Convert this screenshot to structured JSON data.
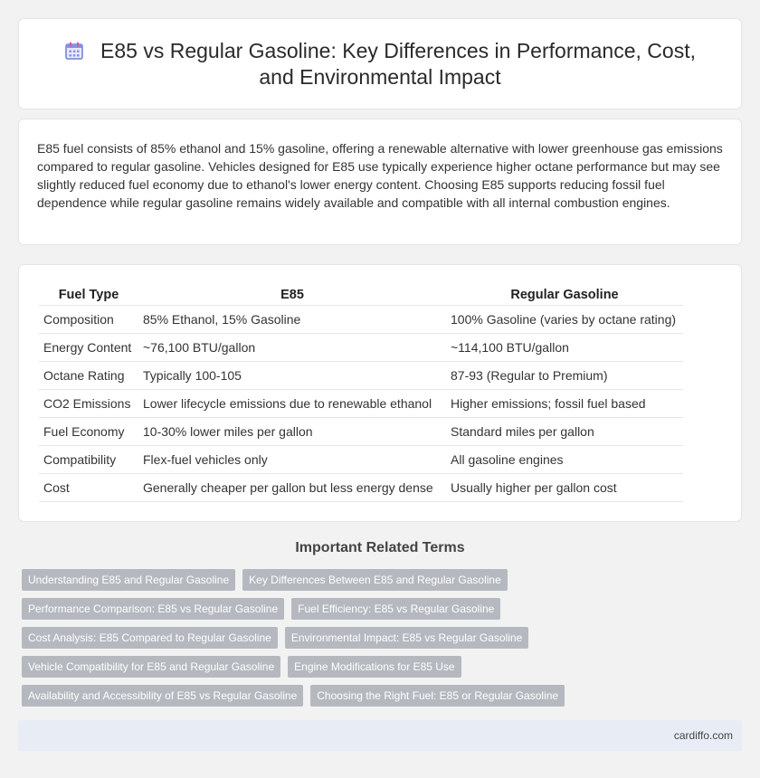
{
  "title": "E85 vs Regular Gasoline: Key Differences in Performance, Cost, and Environmental Impact",
  "title_icon": "calendar-icon",
  "intro": "E85 fuel consists of 85% ethanol and 15% gasoline, offering a renewable alternative with lower greenhouse gas emissions compared to regular gasoline. Vehicles designed for E85 use typically experience higher octane performance but may see slightly reduced fuel economy due to ethanol's lower energy content. Choosing E85 supports reducing fossil fuel dependence while regular gasoline remains widely available and compatible with all internal combustion engines.",
  "table": {
    "headers": [
      "Fuel Type",
      "E85",
      "Regular Gasoline"
    ],
    "rows": [
      [
        "Composition",
        "85% Ethanol, 15% Gasoline",
        "100% Gasoline (varies by octane rating)"
      ],
      [
        "Energy Content",
        "~76,100 BTU/gallon",
        "~114,100 BTU/gallon"
      ],
      [
        "Octane Rating",
        "Typically 100-105",
        "87-93 (Regular to Premium)"
      ],
      [
        "CO2 Emissions",
        "Lower lifecycle emissions due to renewable ethanol",
        "Higher emissions; fossil fuel based"
      ],
      [
        "Fuel Economy",
        "10-30% lower miles per gallon",
        "Standard miles per gallon"
      ],
      [
        "Compatibility",
        "Flex-fuel vehicles only",
        "All gasoline engines"
      ],
      [
        "Cost",
        "Generally cheaper per gallon but less energy dense",
        "Usually higher per gallon cost"
      ]
    ]
  },
  "related": {
    "heading": "Important Related Terms",
    "rows": [
      [
        "Understanding E85 and Regular Gasoline",
        "Key Differences Between E85 and Regular Gasoline"
      ],
      [
        "Performance Comparison: E85 vs Regular Gasoline",
        "Fuel Efficiency: E85 vs Regular Gasoline"
      ],
      [
        "Cost Analysis: E85 Compared to Regular Gasoline",
        "Environmental Impact: E85 vs Regular Gasoline"
      ],
      [
        "Vehicle Compatibility for E85 and Regular Gasoline",
        "Engine Modifications for E85 Use"
      ],
      [
        "Availability and Accessibility of E85 vs Regular Gasoline",
        "Choosing the Right Fuel: E85 or Regular Gasoline"
      ]
    ]
  },
  "footer": "cardiffo.com",
  "colors": {
    "tag_bg": "#b5b9bf",
    "footer_bg": "#e8edf5",
    "icon_accent": "#6b7fd7"
  }
}
